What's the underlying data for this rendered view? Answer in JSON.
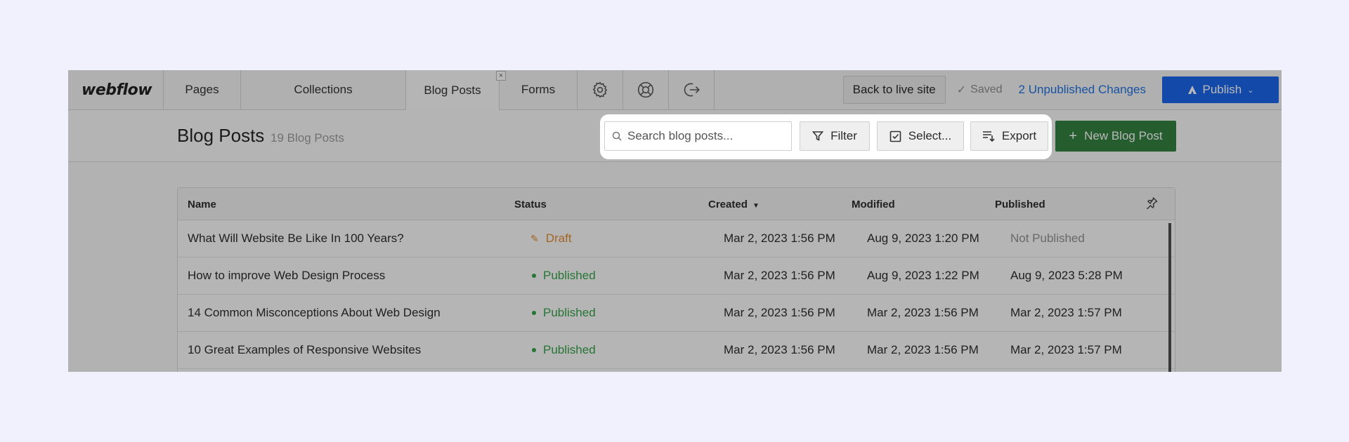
{
  "nav": {
    "logo": "webflow",
    "tabs": [
      {
        "label": "Pages"
      },
      {
        "label": "Collections"
      },
      {
        "label": "Blog Posts"
      },
      {
        "label": "Forms"
      }
    ],
    "tab_close": "×",
    "icons": [
      "gear-icon",
      "help-icon",
      "logout-icon"
    ],
    "back_label": "Back to live site",
    "saved_label": "Saved",
    "unpublished_label": "2 Unpublished Changes",
    "publish_label": "Publish"
  },
  "header": {
    "title": "Blog Posts",
    "count": "19 Blog Posts",
    "search_placeholder": "Search blog posts...",
    "filter_label": "Filter",
    "select_label": "Select...",
    "export_label": "Export",
    "new_label": "New Blog Post",
    "new_plus": "+"
  },
  "table": {
    "columns": [
      "Name",
      "Status",
      "Created",
      "Modified",
      "Published"
    ],
    "rows": [
      {
        "name": "What Will Website Be Like In 100 Years?",
        "status": "Draft",
        "created": "Mar 2, 2023 1:56 PM",
        "modified": "Aug 9, 2023 1:20 PM",
        "published": "Not Published"
      },
      {
        "name": "How to improve Web Design Process",
        "status": "Published",
        "created": "Mar 2, 2023 1:56 PM",
        "modified": "Aug 9, 2023 1:22 PM",
        "published": "Aug 9, 2023 5:28 PM"
      },
      {
        "name": "14 Common Misconceptions About Web Design",
        "status": "Published",
        "created": "Mar 2, 2023 1:56 PM",
        "modified": "Mar 2, 2023 1:56 PM",
        "published": "Mar 2, 2023 1:57 PM"
      },
      {
        "name": "10 Great Examples of Responsive Websites",
        "status": "Published",
        "created": "Mar 2, 2023 1:56 PM",
        "modified": "Mar 2, 2023 1:56 PM",
        "published": "Mar 2, 2023 1:57 PM"
      }
    ]
  },
  "colors": {
    "publish_blue": "#1461e8",
    "new_green": "#2e7d3c",
    "draft_orange": "#e08a2c",
    "published_green": "#2ea043",
    "link_blue": "#1a6ee1"
  }
}
